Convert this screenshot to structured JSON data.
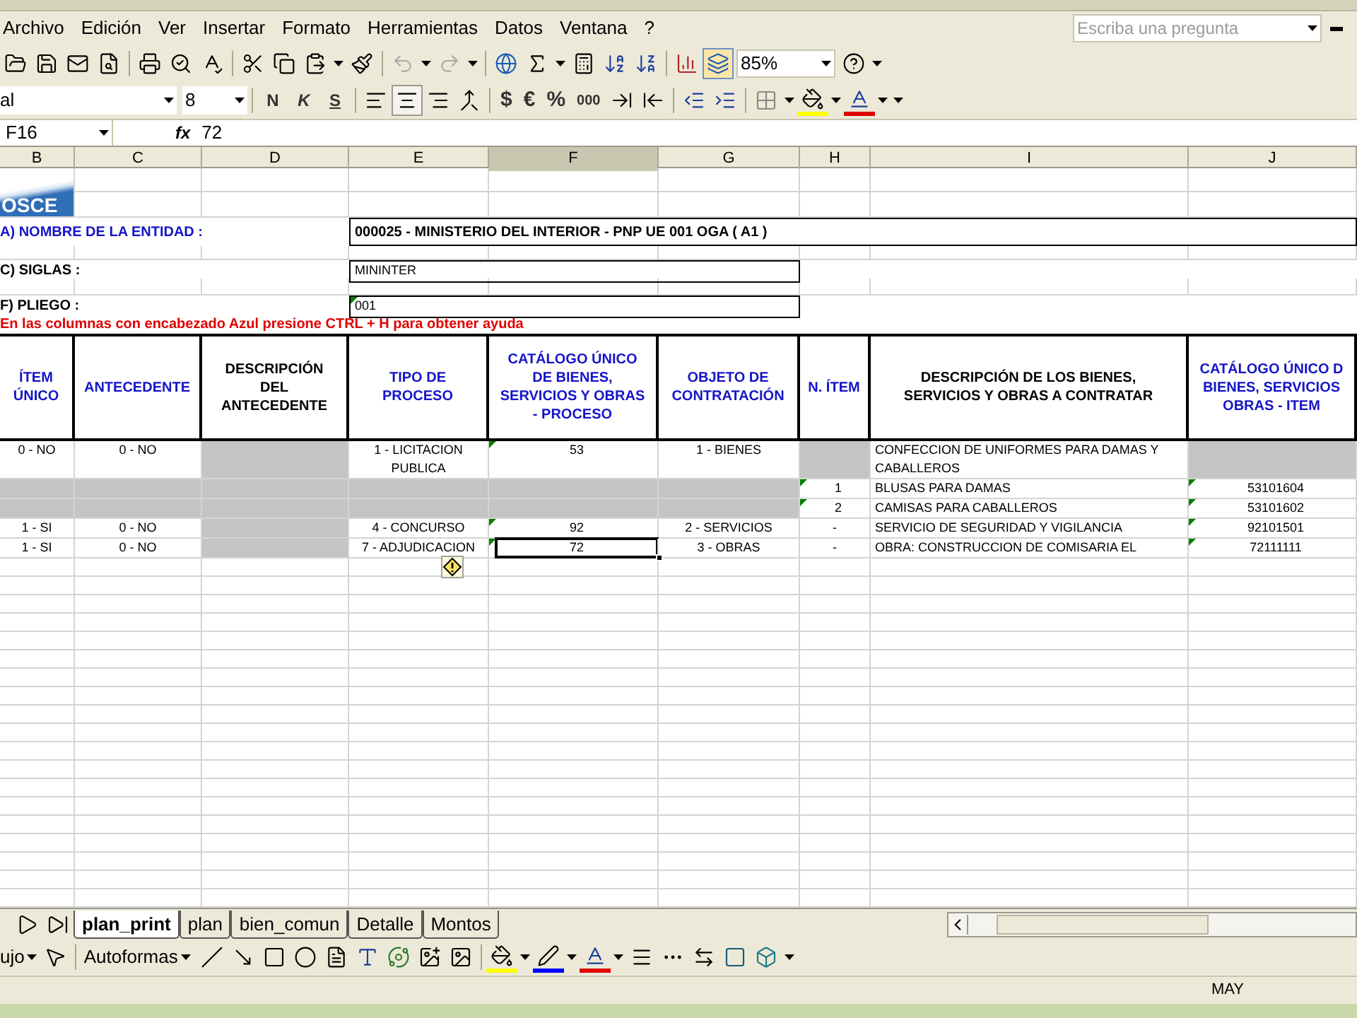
{
  "menu": [
    "Archivo",
    "Edición",
    "Ver",
    "Insertar",
    "Formato",
    "Herramientas",
    "Datos",
    "Ventana",
    "?"
  ],
  "help_search": {
    "placeholder": "Escriba una pregunta"
  },
  "toolbar": {
    "zoom": "85%",
    "font": "al",
    "font_size": "8",
    "style_buttons": [
      "N",
      "K",
      "S"
    ],
    "number_buttons": [
      "$",
      "€",
      "%",
      "000"
    ]
  },
  "formula_bar": {
    "cell": "F16",
    "fx": "fx",
    "value": "72"
  },
  "columns": [
    {
      "label": "B",
      "selected": false
    },
    {
      "label": "C",
      "selected": false
    },
    {
      "label": "D",
      "selected": false
    },
    {
      "label": "E",
      "selected": false
    },
    {
      "label": "F",
      "selected": true
    },
    {
      "label": "G",
      "selected": false
    },
    {
      "label": "H",
      "selected": false
    },
    {
      "label": "I",
      "selected": false
    },
    {
      "label": "J",
      "selected": false
    }
  ],
  "logo": {
    "text": "OSCE"
  },
  "info": [
    {
      "label": "A) NOMBRE DE LA ENTIDAD :",
      "value": "000025 - MINISTERIO DEL INTERIOR - PNP UE 001 OGA ( A1 )",
      "help": true,
      "flag": false,
      "kind": "wide"
    },
    {
      "label": "C) SIGLAS :",
      "value": "MININTER",
      "help": false,
      "flag": false,
      "kind": "narrow"
    },
    {
      "label": "F) PLIEGO :",
      "value": "001",
      "help": false,
      "flag": true,
      "kind": "narrow"
    }
  ],
  "note": "En las columnas con encabezado Azul presione CTRL + H para obtener ayuda",
  "table": {
    "headers": [
      {
        "text": "ÍTEM\nÚNICO",
        "help": true
      },
      {
        "text": "ANTECEDENTE",
        "help": true
      },
      {
        "text": "DESCRIPCIÓN\nDEL\nANTECEDENTE",
        "help": false
      },
      {
        "text": "TIPO DE\nPROCESO",
        "help": true
      },
      {
        "text": "CATÁLOGO ÚNICO\nDE BIENES,\nSERVICIOS Y OBRAS\n- PROCESO",
        "help": true
      },
      {
        "text": "OBJETO DE\nCONTRATACIÓN",
        "help": true
      },
      {
        "text": "N. ÍTEM",
        "help": true
      },
      {
        "text": "DESCRIPCIÓN DE LOS BIENES,\nSERVICIOS Y OBRAS A CONTRATAR",
        "help": false
      },
      {
        "text": "CATÁLOGO ÚNICO D\nBIENES, SERVICIOS\nOBRAS - ITEM",
        "help": true
      }
    ],
    "rows": [
      {
        "cells": [
          {
            "text": "0 - NO",
            "shaded": false,
            "flag": false,
            "selected": false
          },
          {
            "text": "0 - NO",
            "shaded": false,
            "flag": false,
            "selected": false
          },
          {
            "shaded": true,
            "flag": false,
            "selected": false
          },
          {
            "text": "1 - LICITACION PUBLICA",
            "shaded": false,
            "flag": false,
            "selected": false
          },
          {
            "text": "53",
            "shaded": false,
            "flag": true,
            "selected": false
          },
          {
            "text": "1 - BIENES",
            "shaded": false,
            "flag": false,
            "selected": false
          },
          {
            "shaded": true,
            "flag": false,
            "selected": false
          },
          {
            "text": "CONFECCION DE UNIFORMES PARA DAMAS Y CABALLEROS",
            "shaded": false,
            "flag": false,
            "selected": false
          },
          {
            "shaded": true,
            "flag": false,
            "selected": false
          }
        ]
      },
      {
        "cells": [
          {
            "shaded": true,
            "flag": false,
            "selected": false
          },
          {
            "shaded": true,
            "flag": false,
            "selected": false
          },
          {
            "shaded": true,
            "flag": false,
            "selected": false
          },
          {
            "shaded": true,
            "flag": false,
            "selected": false
          },
          {
            "shaded": true,
            "flag": false,
            "selected": false
          },
          {
            "shaded": true,
            "flag": false,
            "selected": false
          },
          {
            "text": "1",
            "shaded": false,
            "flag": true,
            "selected": false
          },
          {
            "text": "BLUSAS PARA DAMAS",
            "shaded": false,
            "flag": false,
            "selected": false
          },
          {
            "text": "53101604",
            "shaded": false,
            "flag": true,
            "selected": false
          }
        ]
      },
      {
        "cells": [
          {
            "shaded": true,
            "flag": false,
            "selected": false
          },
          {
            "shaded": true,
            "flag": false,
            "selected": false
          },
          {
            "shaded": true,
            "flag": false,
            "selected": false
          },
          {
            "shaded": true,
            "flag": false,
            "selected": false
          },
          {
            "shaded": true,
            "flag": false,
            "selected": false
          },
          {
            "shaded": true,
            "flag": false,
            "selected": false
          },
          {
            "text": "2",
            "shaded": false,
            "flag": true,
            "selected": false
          },
          {
            "text": "CAMISAS PARA CABALLEROS",
            "shaded": false,
            "flag": false,
            "selected": false
          },
          {
            "text": "53101602",
            "shaded": false,
            "flag": true,
            "selected": false
          }
        ]
      },
      {
        "cells": [
          {
            "text": "1 - SI",
            "shaded": false,
            "flag": false,
            "selected": false
          },
          {
            "text": "0 - NO",
            "shaded": false,
            "flag": false,
            "selected": false
          },
          {
            "shaded": true,
            "flag": false,
            "selected": false
          },
          {
            "text": "4 - CONCURSO",
            "shaded": false,
            "flag": false,
            "selected": false
          },
          {
            "text": "92",
            "shaded": false,
            "flag": true,
            "selected": false
          },
          {
            "text": "2 - SERVICIOS",
            "shaded": false,
            "flag": false,
            "selected": false
          },
          {
            "text": "-",
            "shaded": false,
            "flag": false,
            "selected": false
          },
          {
            "text": "SERVICIO DE SEGURIDAD Y VIGILANCIA",
            "shaded": false,
            "flag": false,
            "selected": false
          },
          {
            "text": "92101501",
            "shaded": false,
            "flag": true,
            "selected": false
          }
        ]
      },
      {
        "cells": [
          {
            "text": "1 - SI",
            "shaded": false,
            "flag": false,
            "selected": false
          },
          {
            "text": "0 - NO",
            "shaded": false,
            "flag": false,
            "selected": false
          },
          {
            "shaded": true,
            "flag": false,
            "selected": false
          },
          {
            "text": "7 - ADJUDICACION",
            "shaded": false,
            "flag": false,
            "selected": false
          },
          {
            "text": "72",
            "shaded": false,
            "flag": true,
            "selected": true
          },
          {
            "text": "3 - OBRAS",
            "shaded": false,
            "flag": false,
            "selected": false
          },
          {
            "text": "-",
            "shaded": false,
            "flag": false,
            "selected": false
          },
          {
            "text": "OBRA: CONSTRUCCION DE COMISARIA EL",
            "shaded": false,
            "flag": false,
            "selected": false
          },
          {
            "text": "72111111",
            "shaded": false,
            "flag": true,
            "selected": false
          }
        ]
      }
    ]
  },
  "sheet_tabs": [
    {
      "label": "plan_print",
      "selected": true
    },
    {
      "label": "plan",
      "selected": false
    },
    {
      "label": "bien_comun",
      "selected": false
    },
    {
      "label": "Detalle",
      "selected": false
    },
    {
      "label": "Montos",
      "selected": false
    }
  ],
  "drawing_toolbar": {
    "menu": "ujo",
    "autoshapes": "Autoformas"
  },
  "status_bar": {
    "mode": "MAY"
  }
}
